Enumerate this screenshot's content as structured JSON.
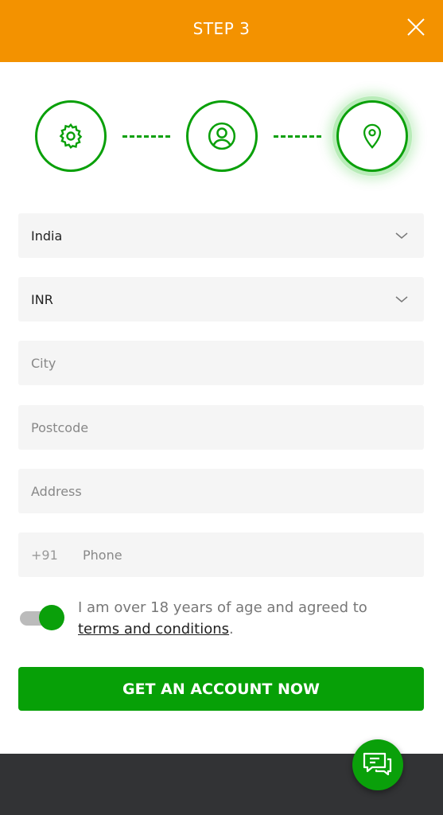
{
  "header": {
    "title": "STEP 3"
  },
  "steps": [
    {
      "icon": "gear-icon",
      "state": "done"
    },
    {
      "icon": "user-icon",
      "state": "done"
    },
    {
      "icon": "location-pin-icon",
      "state": "active"
    }
  ],
  "form": {
    "country": "India",
    "currency": "INR",
    "city_placeholder": "City",
    "postcode_placeholder": "Postcode",
    "address_placeholder": "Address",
    "phone_prefix": "+91",
    "phone_placeholder": "Phone",
    "agree_text": "I am over 18 years of age and agreed to",
    "terms_link": "terms and conditions",
    "agree_period": ".",
    "agree_checked": true,
    "submit": "GET AN ACCOUNT NOW"
  },
  "colors": {
    "header": "#f39200",
    "accent": "#0aa00a",
    "footer": "#323335"
  }
}
